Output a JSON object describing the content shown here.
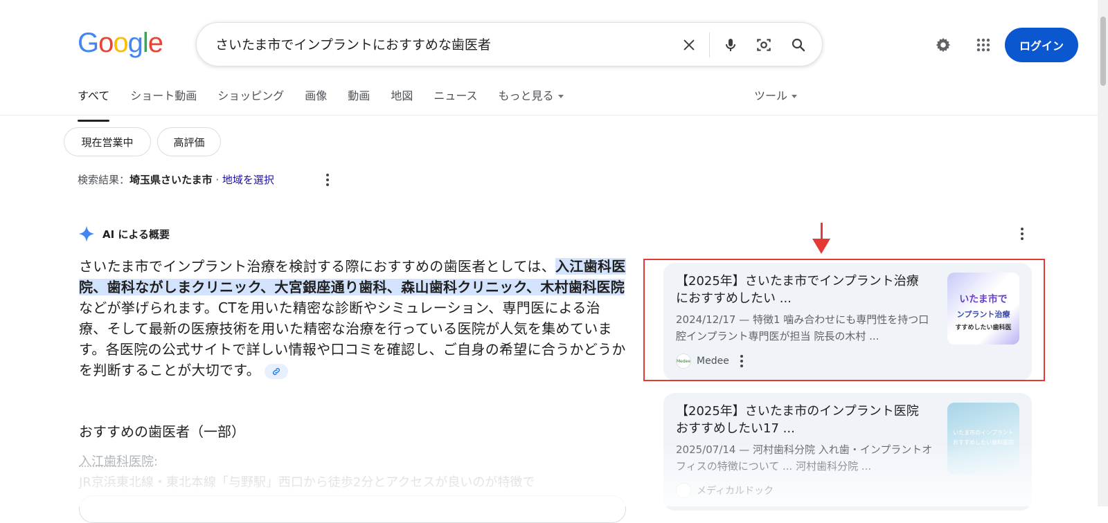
{
  "header": {
    "logo": "Google",
    "search_query": "さいたま市でインプラントにおすすめな歯医者",
    "login_label": "ログイン"
  },
  "tabs": [
    {
      "label": "すべて"
    },
    {
      "label": "ショート動画"
    },
    {
      "label": "ショッピング"
    },
    {
      "label": "画像"
    },
    {
      "label": "動画"
    },
    {
      "label": "地図"
    },
    {
      "label": "ニュース"
    },
    {
      "label": "もっと見る"
    }
  ],
  "tools_label": "ツール",
  "chips": [
    "現在営業中",
    "高評価"
  ],
  "location": {
    "prefix": "検索結果：",
    "place": "埼玉県さいたま市",
    "separator": " · ",
    "link": "地域を選択"
  },
  "ai_overview": {
    "heading": "AI による概要",
    "intro": "さいたま市でインプラント治療を検討する際におすすめの歯医者としては、",
    "highlight": "入江歯科医院、歯科ながしまクリニック、大宮銀座通り歯科、森山歯科クリニック、木村歯科医院",
    "rest": "などが挙げられます。CTを用いた精密な診断やシミュレーション、専門医による治療、そして最新の医療技術を用いた精密な治療を行っている医院が人気を集めています。各医院の公式サイトで詳しい情報や口コミを確認し、ご自身の希望に合うかどうかを判断することが大切です。",
    "subheading": "おすすめの歯医者（一部）",
    "item_title": "入江歯科医院",
    "item_colon": ":",
    "item_desc": "JR京浜東北線・東北本線「与野駅」西口から徒歩2分とアクセスが良いのが特徴で"
  },
  "cards": [
    {
      "title": "【2025年】さいたま市でインプラント治療におすすめしたい ...",
      "snippet": "2024/12/17 — 特徴1 噛み合わせにも専門性を持つ口腔インプラント専門医が担当 院長の木村 ...",
      "source": "Medee",
      "favicon_text": "Medee",
      "thumb_lines": [
        "いたま市で",
        "ンプラント治療",
        "すすめしたい歯科医"
      ]
    },
    {
      "title": "【2025年】さいたま市のインプラント医院 おすすめしたい17 ...",
      "snippet": "2025/07/14 — 河村歯科分院 入れ歯・インプラントオフィスの特徴について ... 河村歯科分院 ...",
      "source": "メディカルドック",
      "thumb_lines": [
        "いたま市のインプラント",
        "おすすめしたい歯科医院"
      ]
    }
  ],
  "colors": {
    "accent_blue": "#0b57d0",
    "highlight": "#d3e3fd",
    "annotation_red": "#e53935"
  }
}
